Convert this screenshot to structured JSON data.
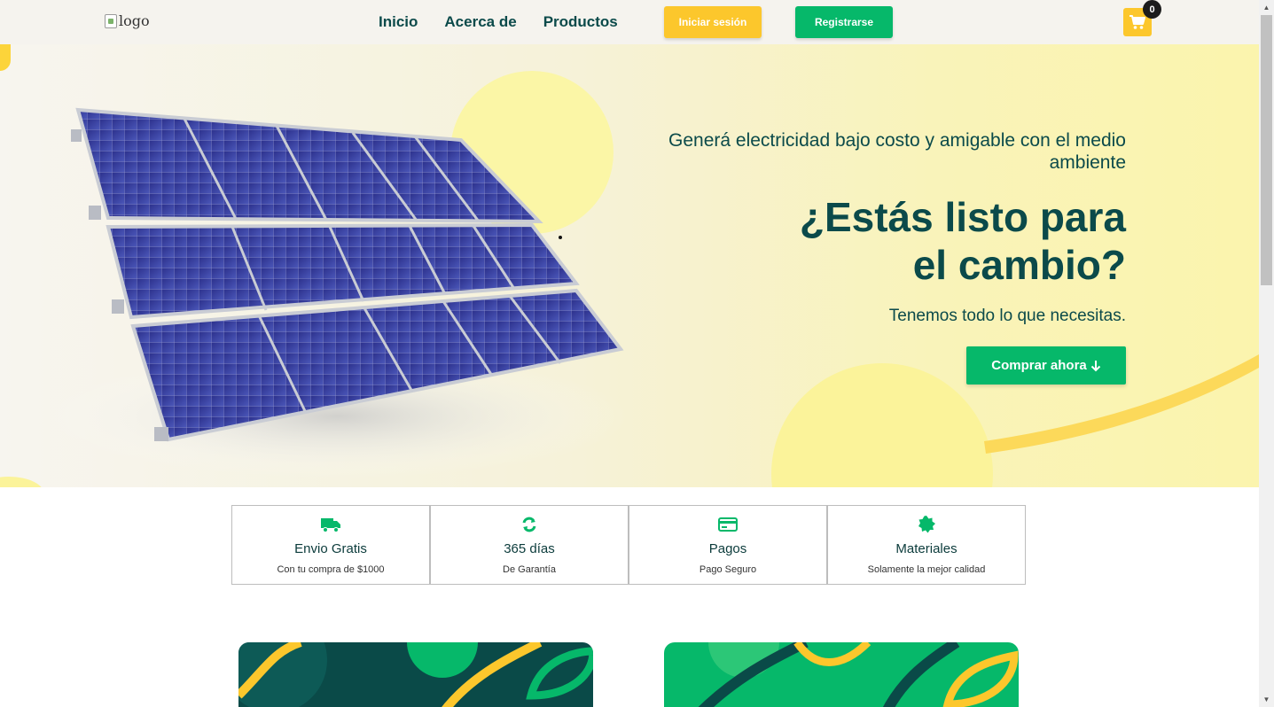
{
  "nav": {
    "logo_alt": "logo",
    "menu": [
      {
        "label": "Inicio"
      },
      {
        "label": "Acerca de"
      },
      {
        "label": "Productos"
      }
    ],
    "login_label": "Iniciar sesión",
    "register_label": "Registrarse",
    "cart_count": "0",
    "icons": {
      "cart": "shopping-cart-icon",
      "logo": "broken-image-icon"
    }
  },
  "hero": {
    "subtitle": "Generá electricidad bajo costo y amigable con el medio ambiente",
    "title_line1": "¿Estás listo para",
    "title_line2": "el cambio?",
    "text": "Tenemos todo lo que necesitas.",
    "cta_label": "Comprar ahora",
    "cta_icon": "arrow-down-icon"
  },
  "features": [
    {
      "icon": "truck-icon",
      "title": "Envio Gratis",
      "desc": "Con tu compra de $1000"
    },
    {
      "icon": "recycle-icon",
      "title": "365 días",
      "desc": "De Garantía"
    },
    {
      "icon": "credit-card-icon",
      "title": "Pagos",
      "desc": "Pago Seguro"
    },
    {
      "icon": "badge-icon",
      "title": "Materiales",
      "desc": "Solamente la mejor calidad"
    }
  ],
  "colors": {
    "brand_dark": "#0b4a4a",
    "brand_green": "#06b86a",
    "brand_yellow": "#fcc72c"
  }
}
